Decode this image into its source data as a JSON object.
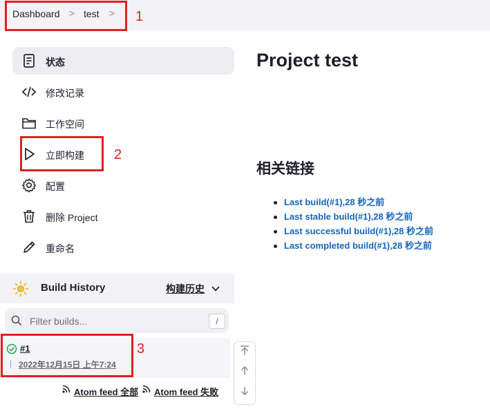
{
  "breadcrumb": {
    "items": [
      "Dashboard",
      "test"
    ],
    "separator": ">"
  },
  "annotations": [
    "1",
    "2",
    "3"
  ],
  "sidebar": {
    "items": [
      {
        "label": "状态",
        "icon": "document-icon",
        "active": true
      },
      {
        "label": "修改记录",
        "icon": "code-icon"
      },
      {
        "label": "工作空间",
        "icon": "folder-icon"
      },
      {
        "label": "立即构建",
        "icon": "play-icon"
      },
      {
        "label": "配置",
        "icon": "gear-icon"
      },
      {
        "label": "删除 Project",
        "icon": "trash-icon"
      },
      {
        "label": "重命名",
        "icon": "pencil-icon"
      }
    ]
  },
  "build_history": {
    "title": "Build History",
    "trend_label": "构建历史",
    "filter_placeholder": "Filter builds...",
    "filter_shortcut": "/",
    "builds": [
      {
        "number": "#1",
        "date": "2022年12月15日 上午7:24",
        "status": "success"
      }
    ],
    "feeds": {
      "all": "Atom feed 全部",
      "failed": "Atom feed 失败"
    }
  },
  "main": {
    "title": "Project test",
    "related_title": "相关链接",
    "links": [
      "Last build(#1),28 秒之前",
      "Last stable build(#1),28 秒之前",
      "Last successful build(#1),28 秒之前",
      "Last completed build(#1),28 秒之前"
    ]
  },
  "colors": {
    "accent_link": "#1565c0",
    "annotation": "#e02020",
    "success": "#1ea64b"
  }
}
